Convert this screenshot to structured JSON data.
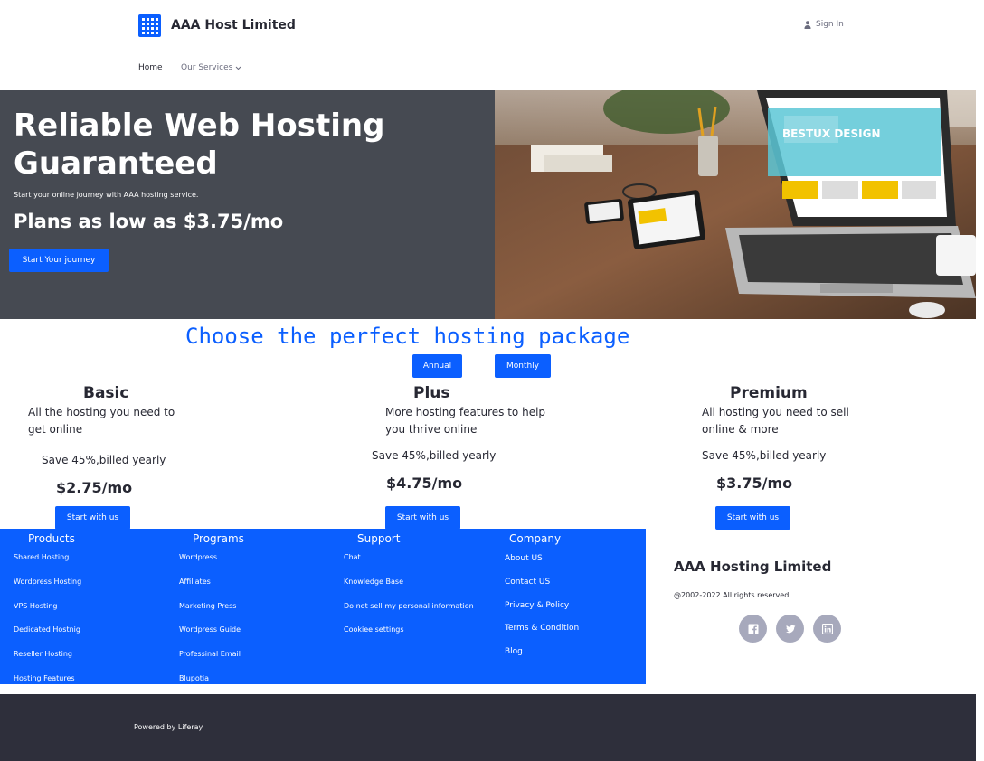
{
  "header": {
    "brand": "AAA Host Limited",
    "sign_in": "Sign In"
  },
  "nav": {
    "home": "Home",
    "services": "Our Services"
  },
  "hero": {
    "title": "Reliable Web Hosting Guaranteed",
    "subtitle": "Start your online journey with AAA hosting service.",
    "price_line": "Plans as low as $3.75/mo",
    "cta": "Start Your journey",
    "image_text": "BESTUX DESIGN"
  },
  "packages": {
    "title": "Choose the perfect hosting package",
    "toggle_annual": "Annual",
    "toggle_monthly": "Monthly",
    "plans": [
      {
        "name": "Basic",
        "desc": "All the hosting you need to get online",
        "save": "Save 45%,billed yearly",
        "price": "$2.75/mo",
        "cta": "Start with us"
      },
      {
        "name": "Plus",
        "desc": "More hosting features to help you thrive online",
        "save": "Save 45%,billed yearly",
        "price": "$4.75/mo",
        "cta": "Start with us"
      },
      {
        "name": "Premium",
        "desc": "All hosting you need to sell online & more",
        "save": "Save 45%,billed yearly",
        "price": "$3.75/mo",
        "cta": "Start with us"
      }
    ]
  },
  "footer": {
    "columns": [
      {
        "title": "Products",
        "links": [
          "Shared Hosting",
          "Wordpress Hosting",
          "VPS Hosting",
          "Dedicated Hostnig",
          "Reseller Hosting",
          "Hosting Features"
        ]
      },
      {
        "title": "Programs",
        "links": [
          "Wordpress",
          "Affiliates",
          "Marketing Press",
          "Wordpress Guide",
          "Professinal Email",
          "Blupotia"
        ]
      },
      {
        "title": "Support",
        "links": [
          "Chat",
          "Knowledge Base",
          "Do not sell my personal information",
          "Cookiee settings"
        ]
      },
      {
        "title": "Company",
        "links": [
          "About US",
          "Contact US",
          "Privacy & Policy",
          "Terms & Condition",
          "Blog"
        ]
      }
    ],
    "company_name": "AAA Hosting Limited",
    "copyright": "@2002-2022 All rights reserved",
    "social_icons": [
      "facebook-icon",
      "twitter-icon",
      "linkedin-icon"
    ],
    "powered_by": "Powered by Liferay"
  },
  "colors": {
    "accent": "#0b5fff",
    "hero_bg": "#464a52",
    "bottom_bar": "#2e2f3b",
    "social_bg": "#a7a9bc"
  }
}
